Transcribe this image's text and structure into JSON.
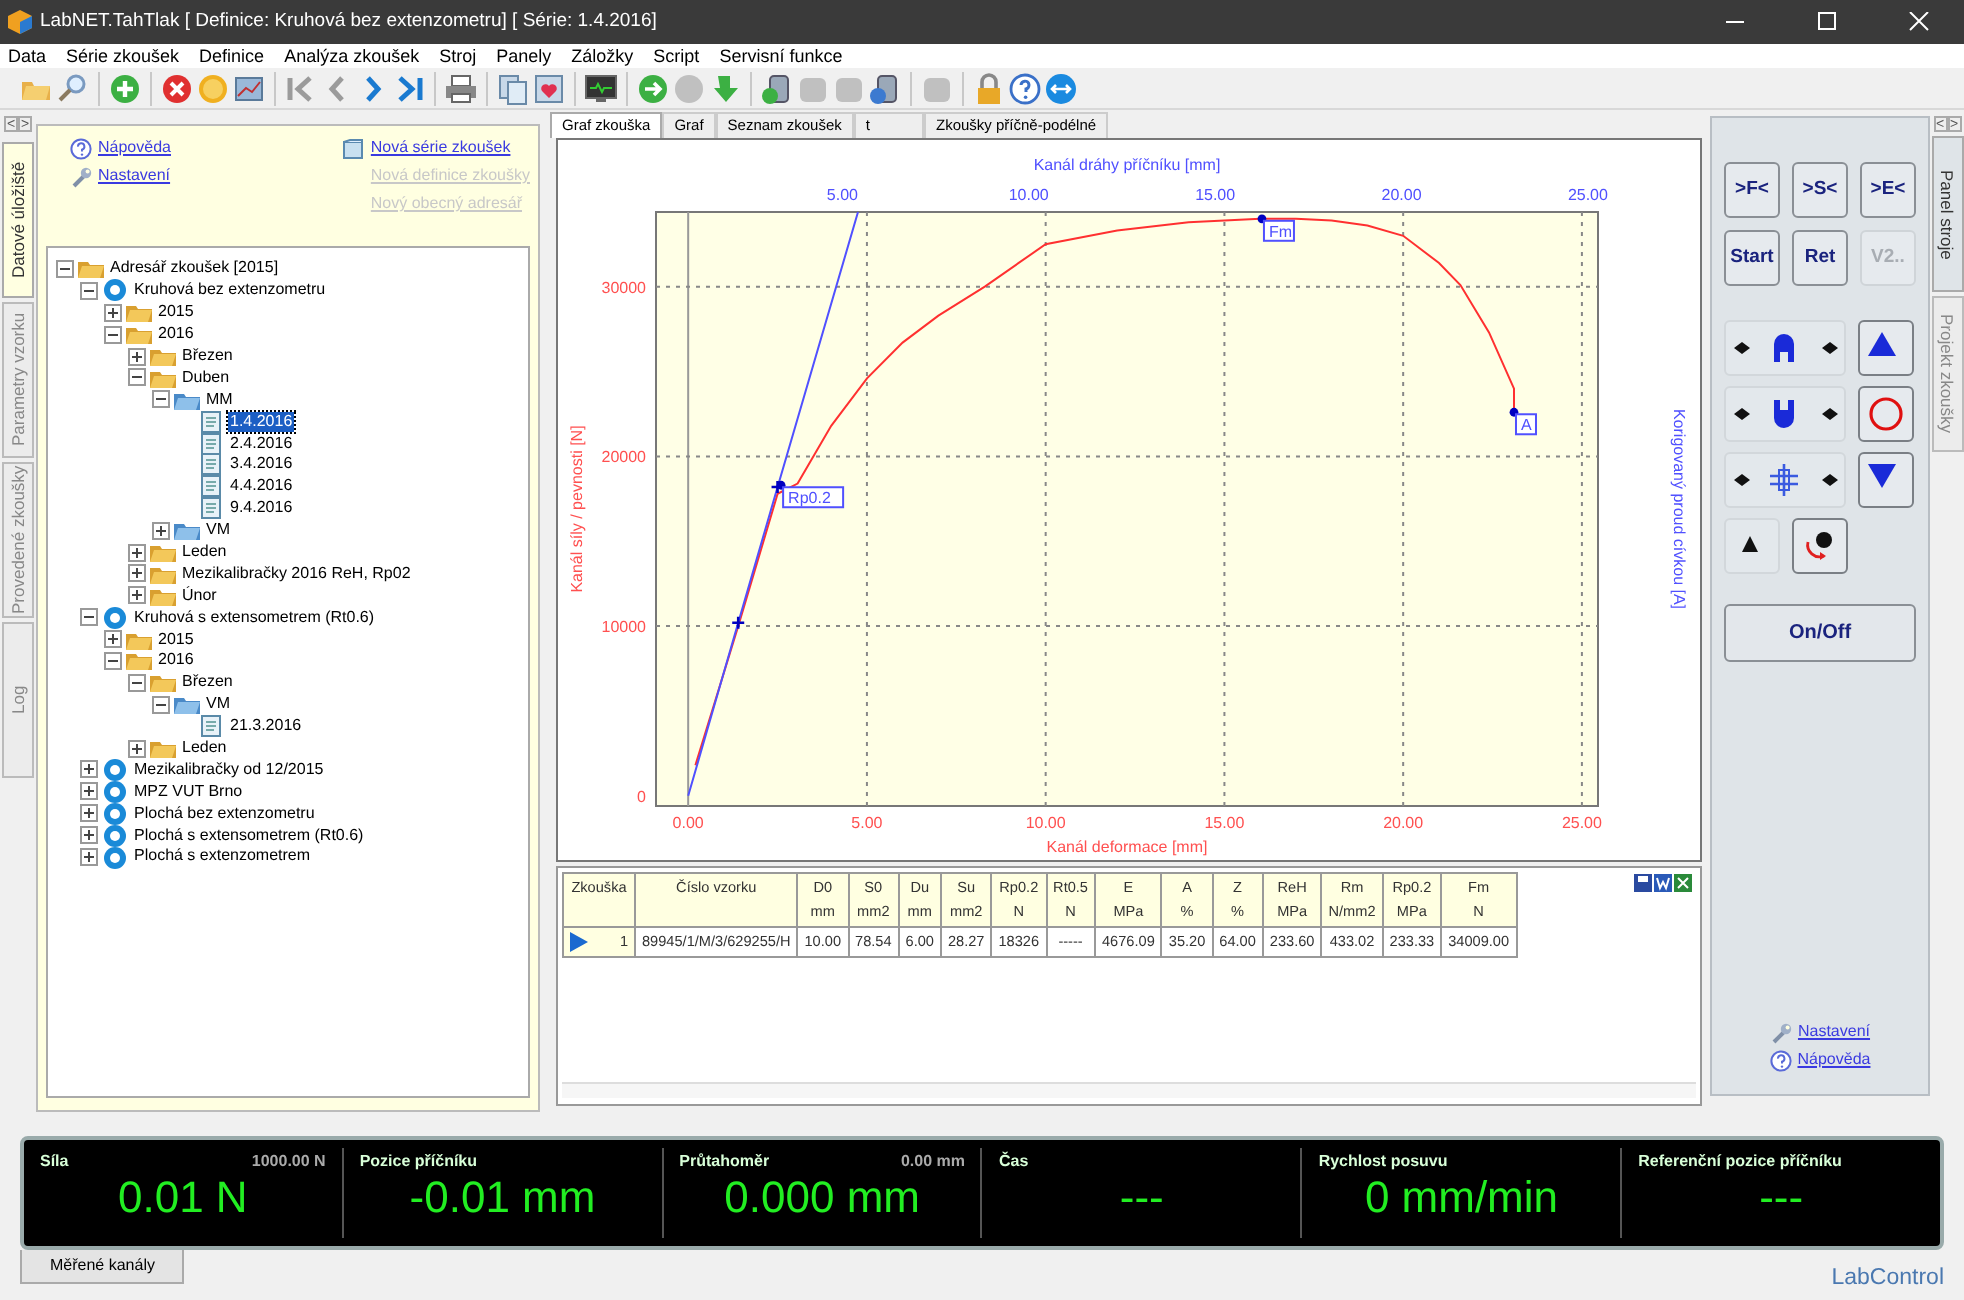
{
  "window": {
    "title": "LabNET.TahTlak [ Definice: Kruhová bez extenzometru]  [ Série: 1.4.2016]"
  },
  "menu": [
    "Data",
    "Série zkoušek",
    "Definice",
    "Analýza zkoušek",
    "Stroj",
    "Panely",
    "Záložky",
    "Script",
    "Servisní funkce"
  ],
  "toolbar": [
    [
      {
        "kind": "open",
        "disabled": false
      },
      {
        "kind": "search",
        "disabled": false
      }
    ],
    [
      {
        "kind": "add",
        "disabled": false
      }
    ],
    [
      {
        "kind": "delete",
        "disabled": false
      },
      {
        "kind": "circle",
        "disabled": false
      },
      {
        "kind": "chart",
        "disabled": false
      }
    ],
    [
      {
        "kind": "first",
        "disabled": true
      },
      {
        "kind": "prev",
        "disabled": true
      },
      {
        "kind": "next",
        "disabled": false
      },
      {
        "kind": "last",
        "disabled": false
      }
    ],
    [
      {
        "kind": "print",
        "disabled": false
      }
    ],
    [
      {
        "kind": "copy",
        "disabled": false
      },
      {
        "kind": "heart",
        "disabled": false
      }
    ],
    [
      {
        "kind": "monitor",
        "disabled": false
      }
    ],
    [
      {
        "kind": "run",
        "disabled": false
      },
      {
        "kind": "stop",
        "disabled": true
      },
      {
        "kind": "download",
        "disabled": false
      }
    ],
    [
      {
        "kind": "dbdown",
        "disabled": false
      },
      {
        "kind": "tool",
        "disabled": true
      },
      {
        "kind": "tool",
        "disabled": true
      },
      {
        "kind": "dbup",
        "disabled": false
      }
    ],
    [
      {
        "kind": "tool",
        "disabled": true
      }
    ],
    [
      {
        "kind": "lock",
        "disabled": false
      },
      {
        "kind": "help",
        "disabled": false
      },
      {
        "kind": "remote",
        "disabled": false
      }
    ]
  ],
  "left_tabs": [
    {
      "label": "Datové úložiště",
      "selected": true
    },
    {
      "label": "Parametry vzorku",
      "selected": false
    },
    {
      "label": "Provedené zkoušky",
      "selected": false
    },
    {
      "label": "Log",
      "selected": false
    }
  ],
  "left_panel": {
    "toggle": [
      "<",
      ">"
    ],
    "links": [
      {
        "kind": "help",
        "label": "Nápověda"
      },
      {
        "kind": "settings",
        "label": "Nastavení"
      }
    ],
    "actions": [
      {
        "kind": "new",
        "label": "Nová série zkoušek",
        "disabled": false
      },
      {
        "label": "Nová definice zkoušky",
        "disabled": true
      },
      {
        "label": "Nový obecný adresář",
        "disabled": true
      }
    ],
    "tree": [
      {
        "label": "Adresář zkoušek  [2015]",
        "kind": "folder",
        "expanded": true,
        "selected": false,
        "children": [
          {
            "label": "Kruhová bez extenzometru",
            "kind": "db",
            "expanded": true,
            "selected": false,
            "children": [
              {
                "label": "2015",
                "kind": "folder",
                "expanded": false,
                "selected": false
              },
              {
                "label": "2016",
                "kind": "folder",
                "expanded": true,
                "selected": false,
                "children": [
                  {
                    "label": "Březen",
                    "kind": "folder",
                    "expanded": false,
                    "selected": false
                  },
                  {
                    "label": "Duben",
                    "kind": "folder",
                    "expanded": true,
                    "selected": false,
                    "children": [
                      {
                        "label": "MM",
                        "kind": "bluefolder",
                        "expanded": true,
                        "selected": false,
                        "children": [
                          {
                            "label": "1.4.2016",
                            "kind": "doc",
                            "selected": true
                          },
                          {
                            "label": "2.4.2016",
                            "kind": "doc",
                            "selected": false
                          },
                          {
                            "label": "3.4.2016",
                            "kind": "doc",
                            "selected": false
                          },
                          {
                            "label": "4.4.2016",
                            "kind": "doc",
                            "selected": false
                          },
                          {
                            "label": "9.4.2016",
                            "kind": "doc",
                            "selected": false
                          }
                        ]
                      },
                      {
                        "label": "VM",
                        "kind": "bluefolder",
                        "expanded": false,
                        "selected": false
                      }
                    ]
                  },
                  {
                    "label": "Leden",
                    "kind": "folder",
                    "expanded": false,
                    "selected": false
                  },
                  {
                    "label": "Mezikalibračky 2016 ReH, Rp02",
                    "kind": "folder",
                    "expanded": false,
                    "selected": false
                  },
                  {
                    "label": "Únor",
                    "kind": "folder",
                    "expanded": false,
                    "selected": false
                  }
                ]
              }
            ]
          },
          {
            "label": "Kruhová s extensometrem (Rt0.6)",
            "kind": "db",
            "expanded": true,
            "selected": false,
            "children": [
              {
                "label": "2015",
                "kind": "folder",
                "expanded": false,
                "selected": false
              },
              {
                "label": "2016",
                "kind": "folder",
                "expanded": true,
                "selected": false,
                "children": [
                  {
                    "label": "Březen",
                    "kind": "folder",
                    "expanded": true,
                    "selected": false,
                    "children": [
                      {
                        "label": "VM",
                        "kind": "bluefolder",
                        "expanded": true,
                        "selected": false,
                        "children": [
                          {
                            "label": "21.3.2016",
                            "kind": "doc",
                            "selected": false
                          }
                        ]
                      }
                    ]
                  },
                  {
                    "label": "Leden",
                    "kind": "folder",
                    "expanded": false,
                    "selected": false
                  }
                ]
              }
            ]
          },
          {
            "label": "Mezikalibračky od 12/2015",
            "kind": "db",
            "expanded": false,
            "selected": false
          },
          {
            "label": "MPZ VUT Brno",
            "kind": "db",
            "expanded": false,
            "selected": false
          },
          {
            "label": "Plochá bez extenzometru",
            "kind": "db",
            "expanded": false,
            "selected": false
          },
          {
            "label": "Plochá s extensometrem (Rt0.6)",
            "kind": "db",
            "expanded": false,
            "selected": false
          },
          {
            "label": "Plochá s extenzometrem",
            "kind": "db",
            "expanded": false,
            "selected": false
          }
        ]
      }
    ]
  },
  "center_tabs": [
    {
      "label": "Graf zkouška",
      "selected": true
    },
    {
      "label": "Graf",
      "selected": false
    },
    {
      "label": "Seznam zkoušek",
      "selected": false
    },
    {
      "label": "t",
      "selected": false
    },
    {
      "label": "Zkoušky příčně-podélné",
      "selected": false
    }
  ],
  "graph": {
    "top_axis": {
      "label": "Kanál dráhy příčníku  [mm]",
      "ticks": [
        "5.00",
        "10.00",
        "15.00",
        "20.00",
        "25.00"
      ]
    },
    "right_axis_label": "Korigovaný proud cívkou [A]",
    "chart_data": {
      "type": "line",
      "grid": true,
      "xlabel": "Kanál deformace  [mm]",
      "ylabel": "Kanál síly / pevnosti  [N]",
      "xlim": [
        -0.9,
        25.45
      ],
      "ylim": [
        -600,
        34400
      ],
      "xticks": [
        {
          "value": 0,
          "label": "0.00"
        },
        {
          "value": 5,
          "label": "5.00"
        },
        {
          "value": 10,
          "label": "10.00"
        },
        {
          "value": 15,
          "label": "15.00"
        },
        {
          "value": 20,
          "label": "20.00"
        },
        {
          "value": 25,
          "label": "25.00"
        }
      ],
      "yticks": [
        0,
        10000,
        20000,
        30000
      ],
      "series": [
        {
          "color": "#ff3030",
          "x": [
            0.2,
            1.4,
            2.5,
            3.06,
            4,
            5,
            6,
            7,
            8.3,
            10,
            12,
            14,
            16,
            17,
            18,
            19,
            20,
            21,
            21.6,
            22.4,
            23.1,
            23.1
          ],
          "values": [
            1800,
            10000,
            17800,
            18400,
            21800,
            24600,
            26700,
            28300,
            30000,
            32500,
            33300,
            33800,
            34000,
            34000,
            33900,
            33600,
            33000,
            31400,
            30100,
            27300,
            24000,
            22600
          ]
        },
        {
          "color": "#5050ff",
          "x": [
            0,
            1.4,
            2.5,
            4.75
          ],
          "values": [
            0,
            10200,
            18200,
            34400
          ]
        }
      ],
      "annotations": [
        {
          "text": "Rp0.2",
          "x": 2.6,
          "y": 18300
        },
        {
          "text": "Fm",
          "x": 16.05,
          "y": 34000
        },
        {
          "text": "A",
          "x": 23.1,
          "y": 22600
        }
      ]
    }
  },
  "table": {
    "columns": [
      {
        "name": "Zkouška"
      },
      {
        "name": "Číslo vzorku"
      },
      {
        "name": "D0",
        "unit": "mm"
      },
      {
        "name": "S0",
        "unit": "mm2"
      },
      {
        "name": "Du",
        "unit": "mm"
      },
      {
        "name": "Su",
        "unit": "mm2"
      },
      {
        "name": "Rp0.2",
        "unit": "N"
      },
      {
        "name": "Rt0.5",
        "unit": "N"
      },
      {
        "name": "E",
        "unit": "MPa"
      },
      {
        "name": "A",
        "unit": "%"
      },
      {
        "name": "Z",
        "unit": "%"
      },
      {
        "name": "ReH",
        "unit": "MPa"
      },
      {
        "name": "Rm",
        "unit": "N/mm2"
      },
      {
        "name": "Rp0.2",
        "unit": "MPa"
      },
      {
        "name": "Fm",
        "unit": "N"
      }
    ],
    "rows": [
      {
        "selected": true,
        "cells": [
          "1",
          "89945/1/M/3/629255/H",
          "10.00",
          "78.54",
          "6.00",
          "28.27",
          "18326",
          "-----",
          "4676.09",
          "35.20",
          "64.00",
          "233.60",
          "433.02",
          "233.33",
          "34009.00"
        ]
      }
    ]
  },
  "machine_panel": {
    "toggle": [
      "<",
      ">"
    ],
    "buttons": [
      {
        "label": ">F<",
        "disabled": false
      },
      {
        "label": ">S<",
        "disabled": false
      },
      {
        "label": ">E<",
        "disabled": false
      },
      {
        "label": "Start",
        "disabled": false
      },
      {
        "label": "Ret",
        "disabled": false
      },
      {
        "label": "V2..",
        "disabled": true
      }
    ],
    "controls": [
      {
        "kind": "upper-grip",
        "disabled": true
      },
      {
        "kind": "up",
        "disabled": false
      },
      {
        "kind": "lower-grip",
        "disabled": true
      },
      {
        "kind": "stop",
        "disabled": false
      },
      {
        "kind": "extensometer",
        "disabled": true
      },
      {
        "kind": "down",
        "disabled": false
      },
      {
        "kind": "crosshead",
        "disabled": true
      },
      {
        "kind": "rotate",
        "disabled": false
      }
    ],
    "power": "On/Off",
    "links": [
      {
        "kind": "settings",
        "label": "Nastavení"
      },
      {
        "kind": "help",
        "label": "Nápověda"
      }
    ]
  },
  "right_tabs": [
    {
      "label": "Panel stroje",
      "selected": true
    },
    {
      "label": "Projekt zkoušky",
      "selected": false
    }
  ],
  "channels": [
    {
      "name": "Síla",
      "range": "1000.00 N",
      "value": "0.01 N"
    },
    {
      "name": "Pozice příčníku",
      "value": "-0.01 mm"
    },
    {
      "name": "Průtahoměr",
      "range": "0.00 mm",
      "value": "0.000 mm"
    },
    {
      "name": "Čas",
      "value": "---"
    },
    {
      "name": "Rychlost posuvu",
      "value": "0 mm/min"
    },
    {
      "name": "Referenční pozice příčníku",
      "value": "---"
    }
  ],
  "bottom_tabs": [
    {
      "label": "Měřené kanály",
      "selected": true
    }
  ],
  "brand": "LabControl"
}
